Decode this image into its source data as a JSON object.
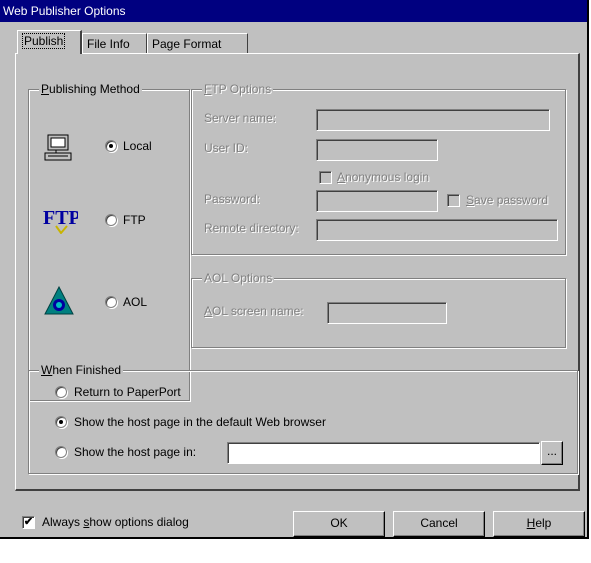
{
  "window": {
    "title": "Web Publisher Options"
  },
  "tabs": [
    {
      "label": "Publish",
      "active": true
    },
    {
      "label": "File Info",
      "active": false
    },
    {
      "label": "Page Format",
      "active": false
    }
  ],
  "publishing_method": {
    "legend": "Publishing Method",
    "options": [
      {
        "label": "Local",
        "selected": true,
        "icon": "computer-icon"
      },
      {
        "label": "FTP",
        "selected": false,
        "icon": "ftp-icon"
      },
      {
        "label": "AOL",
        "selected": false,
        "icon": "aol-icon"
      }
    ]
  },
  "ftp_options": {
    "legend": "FTP Options",
    "server_name_label": "Server name:",
    "server_name_value": "",
    "user_id_label": "User ID:",
    "user_id_value": "",
    "anonymous_login_label": "Anonymous login",
    "anonymous_login_checked": false,
    "password_label": "Password:",
    "password_value": "",
    "save_password_label": "Save password",
    "save_password_checked": false,
    "remote_directory_label": "Remote directory:",
    "remote_directory_value": ""
  },
  "aol_options": {
    "legend": "AOL Options",
    "screen_name_label": "AOL screen name:",
    "screen_name_value": ""
  },
  "when_finished": {
    "legend": "When Finished",
    "options": [
      {
        "label": "Return to PaperPort",
        "selected": false
      },
      {
        "label": "Show the host page in the default Web browser",
        "selected": true
      },
      {
        "label": "Show the host page in:",
        "selected": false
      }
    ],
    "host_page_value": "",
    "browse_label": "..."
  },
  "footer": {
    "always_show_label": "Always show options dialog",
    "always_show_checked": true,
    "ok_label": "OK",
    "cancel_label": "Cancel",
    "help_label": "Help"
  },
  "colors": {
    "titlebar": "#000080",
    "face": "#c0c0c0",
    "disabled_text": "#808080"
  }
}
